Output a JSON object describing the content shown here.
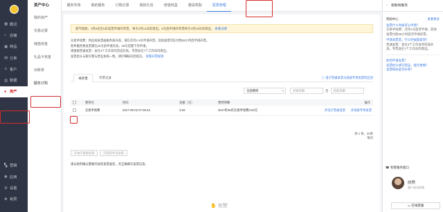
{
  "rail": {
    "items": [
      {
        "icon": "▦",
        "label": "概况"
      },
      {
        "icon": "⌂",
        "label": "店铺"
      },
      {
        "icon": "▣",
        "label": "商品"
      },
      {
        "icon": "▤",
        "label": "订单"
      },
      {
        "icon": "♙",
        "label": "客户"
      },
      {
        "icon": "▥",
        "label": "数据"
      },
      {
        "icon": "●",
        "label": "资产"
      }
    ],
    "bottom": [
      {
        "icon": "▚",
        "label": "营销"
      },
      {
        "icon": "◉",
        "label": "应用"
      },
      {
        "icon": "⚙",
        "label": "设置"
      },
      {
        "icon": "✚",
        "label": "有赞"
      }
    ]
  },
  "subnav": {
    "title": "资产中心",
    "items": [
      "我的资产",
      "交易记录",
      "储值资金",
      "礼品卡资金",
      "对账单",
      "服务订购"
    ]
  },
  "topbar": {
    "tabs": [
      "服务市场",
      "我的服务",
      "订购记录",
      "我的礼包",
      "增值权益",
      "邀请奖励",
      "发票管理"
    ]
  },
  "notice": {
    "text": "春节假期，2月8日至6日发票申请的专票，将于2月14日前寄出，8号后申请的专票将于2月23日前寄出。",
    "link": "查看详情"
  },
  "info": {
    "lines": [
      "交易手续费：供应商发票由服务商开具，请在次月1-5号申请开票，其他发票可在付款48小时后申请开票。",
      "软件服务费发票需在25号前申请开具，26号后需下月申请。",
      "增值税普通发票：会在3个工作日内完成开具，专票会在7个工作日内寄出。",
      "发票抬头与税号需与营业执照一致，请仔细核对后提交。"
    ],
    "link": "查看开票规则"
  },
  "tabs": {
    "items": [
      "待开票",
      "开票记录"
    ],
    "link": "电子普通发票与纸质专用发票的区别"
  },
  "filters": {
    "type": "全部费用",
    "start_placeholder": "开始日期",
    "to": "至",
    "end_placeholder": "结束日期"
  },
  "table": {
    "columns": [
      "费用名",
      "时间",
      "金额（元）",
      "费用明细",
      "操作"
    ],
    "rows": [
      {
        "name": "交易手续费",
        "time": "2017-09-02 07:28:43",
        "amount": "3.93",
        "detail": "2017年08月交易手续费3.93元",
        "op1": "开电子普通发票",
        "op2": "开纸质专用发票"
      }
    ]
  },
  "pager": {
    "line1": "共 1 条，20条",
    "line2": "每页"
  },
  "batch": {
    "btn1": "开电子普通发票",
    "btn2": "开纸质专用发票"
  },
  "tip": "请与财务确认需要开具的发票类型，开正确填写发票信息。",
  "footer_logo": "有赞",
  "right": {
    "head": "帮助和服务",
    "help_label": "帮助中心",
    "help_more": "查看更多",
    "faqs": [
      {
        "q": "发票什么时候可以申请？",
        "a": "交易手续费：次月1号后可申请；其他发票付款48小时后可申请开票。"
      },
      {
        "q": "申请发票后，什么时候能拿到？",
        "a": "普通发票：会在3个工作日内完成开具，专票会在7个工作日内寄出。"
      }
    ],
    "links": [
      "如何申请发票？",
      "发票抬头填写错误，能否更换？",
      "发票缺失是否补寄？"
    ],
    "service_head": "有赞服务窗口",
    "service_name": "欣然",
    "service_role": "客户成功经理",
    "service_btn": "在线客服"
  }
}
